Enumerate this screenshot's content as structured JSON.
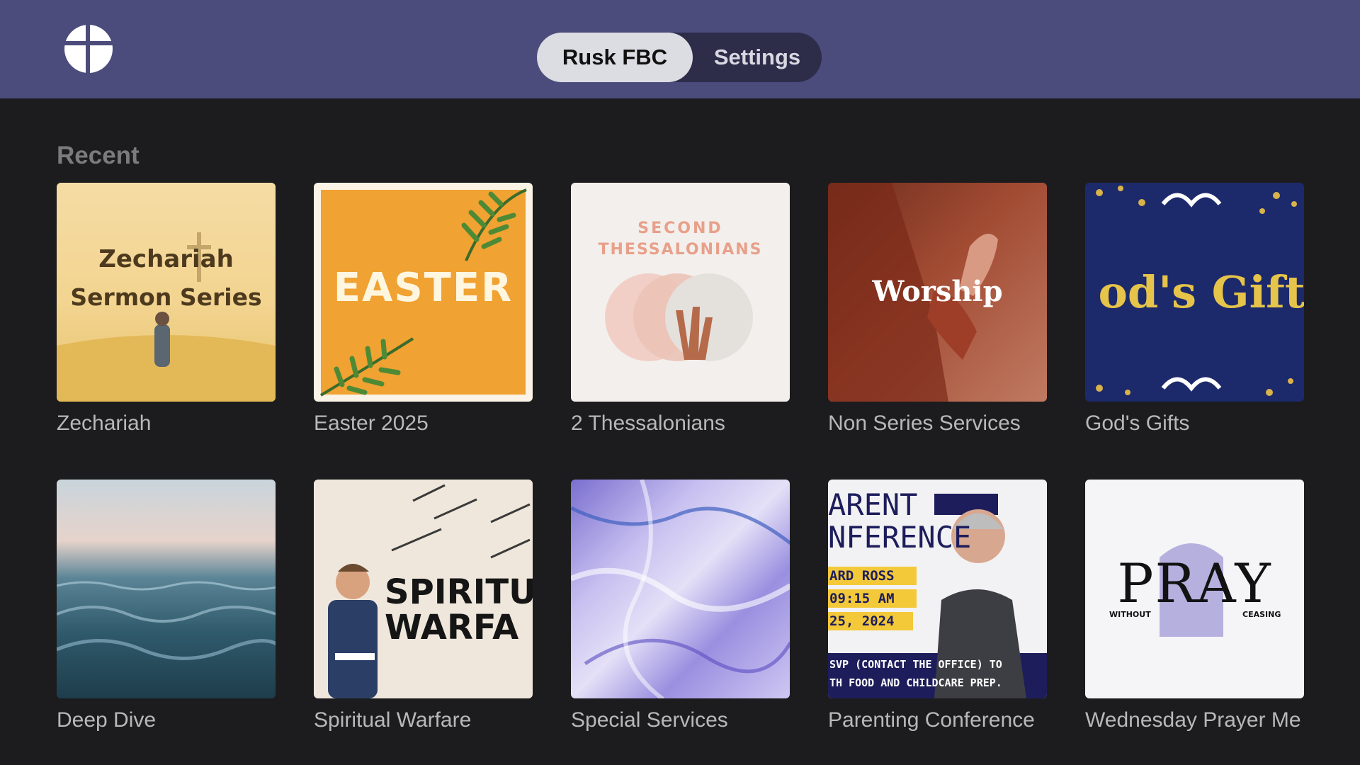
{
  "header": {
    "tabs": [
      {
        "label": "Rusk FBC",
        "active": true
      },
      {
        "label": "Settings",
        "active": false
      }
    ]
  },
  "section": {
    "title": "Recent"
  },
  "items": [
    {
      "title": "Zechariah",
      "art_lines": [
        "Zechariah",
        "Sermon Series"
      ]
    },
    {
      "title": "Easter 2025",
      "art_lines": [
        "EASTER"
      ]
    },
    {
      "title": "2 Thessalonians",
      "art_lines": [
        "SECOND",
        "THESSALONIANS"
      ]
    },
    {
      "title": "Non Series Services",
      "art_lines": [
        "Worship"
      ]
    },
    {
      "title": "God's Gifts",
      "art_lines": [
        "od's Gift"
      ]
    },
    {
      "title": "Deep Dive",
      "art_lines": []
    },
    {
      "title": "Spiritual Warfare",
      "art_lines": [
        "SPIRITU",
        "WARFA"
      ]
    },
    {
      "title": "Special Services",
      "art_lines": []
    },
    {
      "title": "Parenting Conference",
      "art_lines": [
        "ARENT",
        "NFERENCE",
        "ARD ROSS",
        "09:15 AM",
        "25, 2024",
        "SVP (CONTACT THE OFFICE) TO",
        "TH FOOD AND CHILDCARE PREP."
      ]
    },
    {
      "title": "Wednesday Prayer Me",
      "art_lines": [
        "PRAY",
        "WITHOUT",
        "CEASING"
      ]
    }
  ],
  "colors": {
    "header_bg": "#4b4b7c",
    "page_bg": "#1c1c1e",
    "active_tab_bg": "#dcdce3"
  }
}
